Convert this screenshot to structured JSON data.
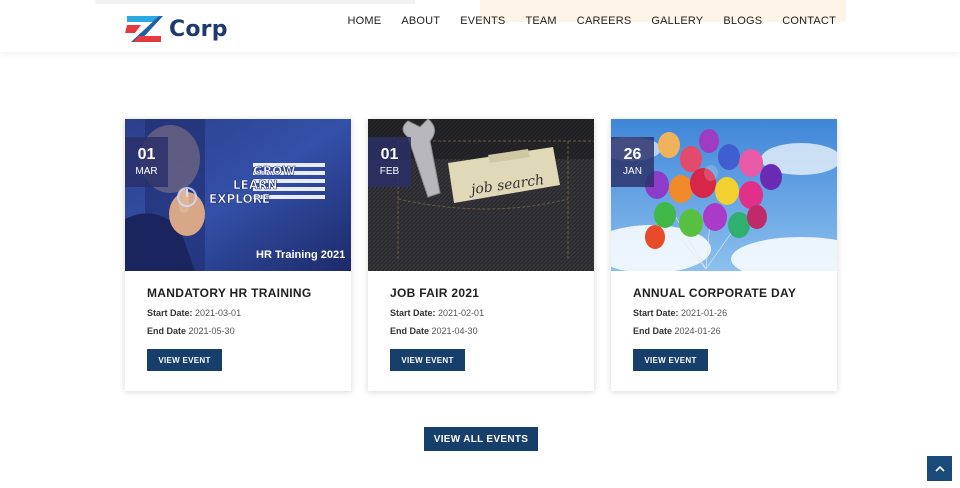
{
  "brand": {
    "name": "Corp",
    "colors": {
      "blue": "#2aa8e0",
      "red": "#e53a40",
      "navy": "#1e3a6e"
    }
  },
  "nav": [
    "HOME",
    "ABOUT",
    "EVENTS",
    "TEAM",
    "CAREERS",
    "GALLERY",
    "BLOGS",
    "CONTACT"
  ],
  "events": [
    {
      "day": "01",
      "month": "MAR",
      "title": "MANDATORY HR TRAINING",
      "start_label": "Start Date:",
      "start": "2021-03-01",
      "end_label": "End Date",
      "end": "2021-05-30",
      "button": "VIEW EVENT",
      "image_text": [
        "GROW",
        "LEARN",
        "EXPLORE"
      ],
      "caption": "HR Training 2021"
    },
    {
      "day": "01",
      "month": "FEB",
      "title": "JOB FAIR 2021",
      "start_label": "Start Date:",
      "start": "2021-02-01",
      "end_label": "End Date",
      "end": "2021-04-30",
      "button": "VIEW EVENT",
      "tag_text": "job search"
    },
    {
      "day": "26",
      "month": "JAN",
      "title": "ANNUAL CORPORATE DAY",
      "start_label": "Start Date:",
      "start": "2021-01-26",
      "end_label": "End Date",
      "end": "2024-01-26",
      "button": "VIEW EVENT"
    }
  ],
  "view_all": "VIEW ALL EVENTS",
  "accent": "#16406b",
  "scroll_icon": "chevron-up-icon"
}
